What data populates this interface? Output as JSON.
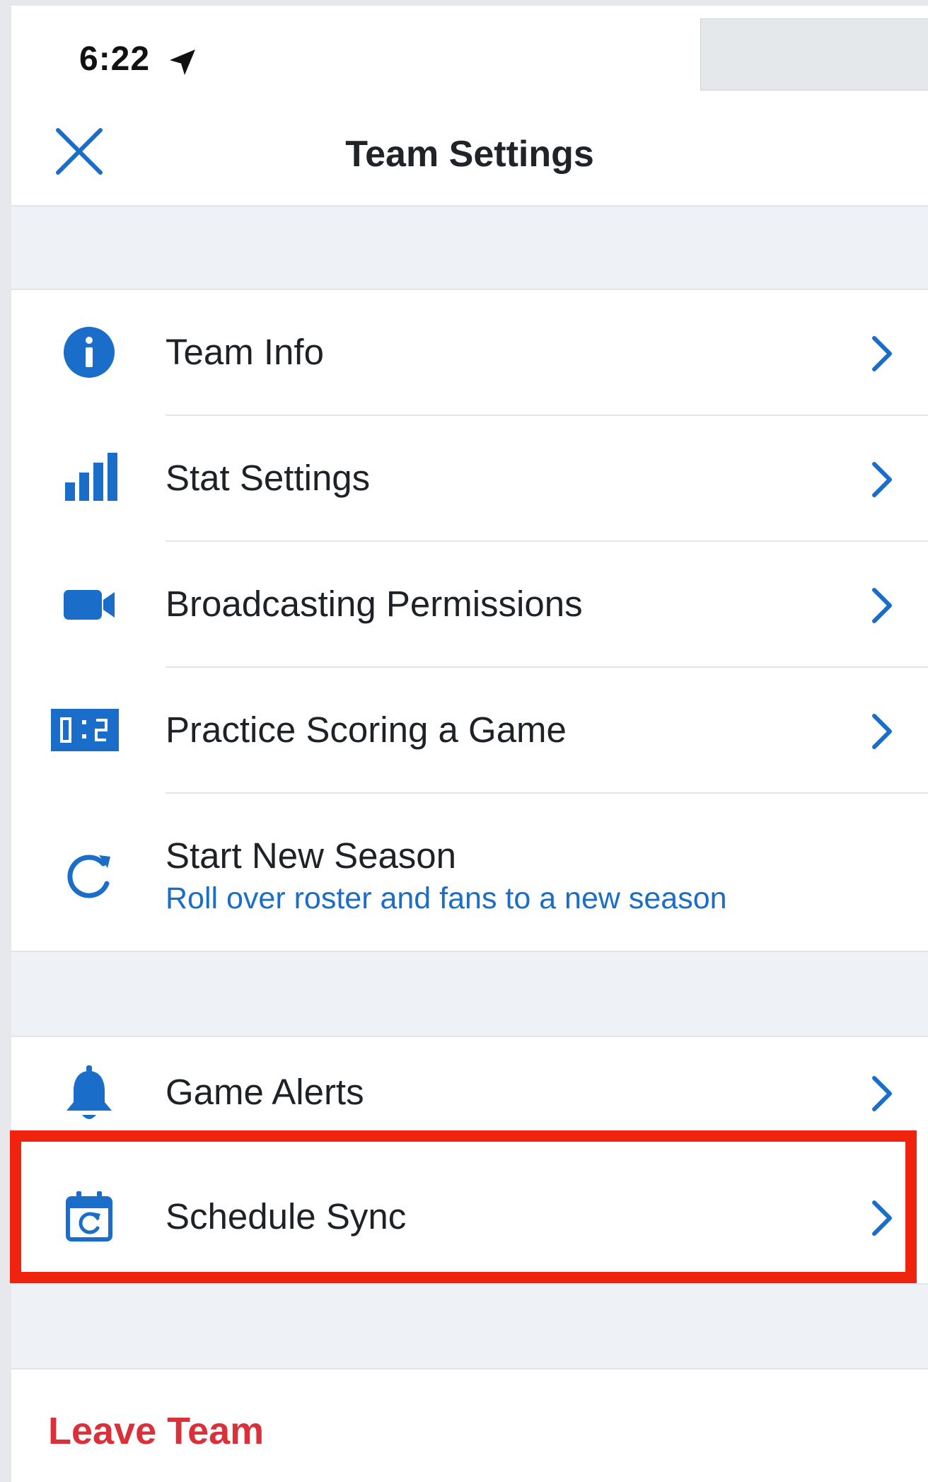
{
  "status_bar": {
    "time": "6:22",
    "location_icon": "location-arrow-icon"
  },
  "nav": {
    "title": "Team Settings",
    "close_icon": "close-icon"
  },
  "colors": {
    "accent": "#1a6dc8",
    "destructive": "#d9313a",
    "highlight": "#f0230f",
    "section_background": "#eef1f6"
  },
  "settings_section": {
    "items": [
      {
        "label": "Team Info",
        "icon": "info-circle-icon"
      },
      {
        "label": "Stat Settings",
        "icon": "bar-chart-icon"
      },
      {
        "label": "Broadcasting Permissions",
        "icon": "video-camera-icon"
      },
      {
        "label": "Practice Scoring a Game",
        "icon": "scoreboard-icon"
      },
      {
        "label": "Start New Season",
        "sublabel": "Roll over roster and fans to a new season",
        "icon": "refresh-icon"
      }
    ]
  },
  "notifications_section": {
    "items": [
      {
        "label": "Game Alerts",
        "icon": "bell-icon"
      },
      {
        "label": "Schedule Sync",
        "icon": "calendar-sync-icon",
        "highlighted": true
      }
    ]
  },
  "footer": {
    "leave_team_label": "Leave Team"
  }
}
